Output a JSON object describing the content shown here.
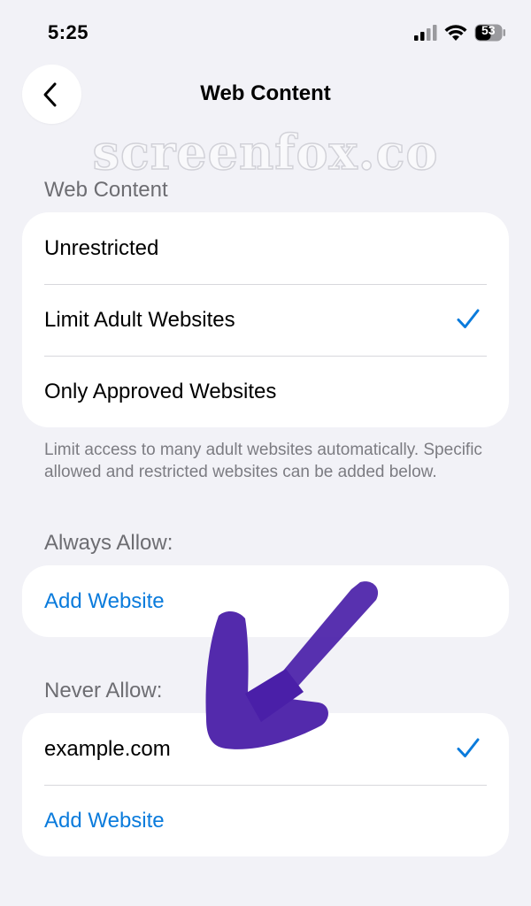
{
  "status_bar": {
    "time": "5:25",
    "battery": "53",
    "signal_icon": "cellular-signal-icon",
    "wifi_icon": "wifi-icon",
    "battery_icon": "battery-icon"
  },
  "nav": {
    "title": "Web Content",
    "back_icon": "chevron-left-icon"
  },
  "watermark": "screenfox.co",
  "web_content": {
    "header": "Web Content",
    "options": [
      {
        "label": "Unrestricted",
        "selected": false
      },
      {
        "label": "Limit Adult Websites",
        "selected": true
      },
      {
        "label": "Only Approved Websites",
        "selected": false
      }
    ],
    "footer": "Limit access to many adult websites automatically. Specific allowed and restricted websites can be added below."
  },
  "always_allow": {
    "header": "Always Allow:",
    "add_label": "Add Website"
  },
  "never_allow": {
    "header": "Never Allow:",
    "items": [
      {
        "label": "example.com",
        "selected": true
      }
    ],
    "add_label": "Add Website"
  },
  "colors": {
    "accent": "#0a7bdc",
    "background": "#f2f2f7",
    "annotation_arrow": "#4a1fa8"
  }
}
